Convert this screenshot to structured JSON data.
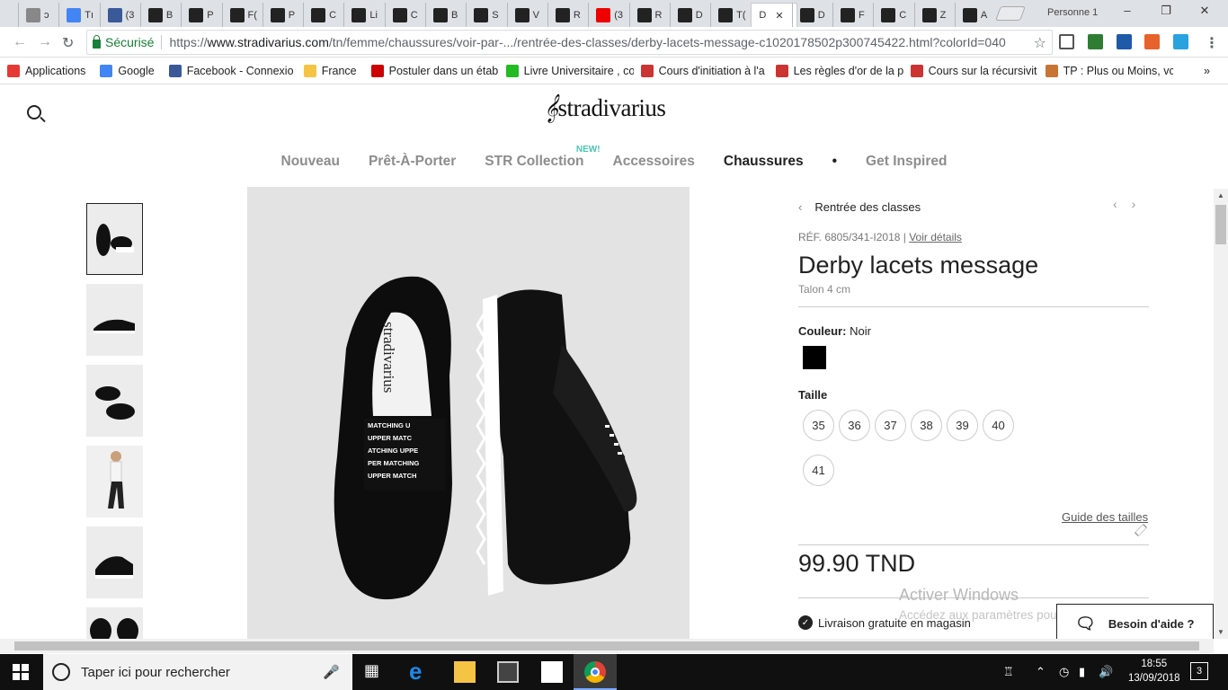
{
  "browser": {
    "tabs": [
      {
        "label": "ɔ",
        "icon": "doc-icon",
        "color": "#888"
      },
      {
        "label": "Tı",
        "icon": "google-icon",
        "color": "#4285f4"
      },
      {
        "label": "(3",
        "icon": "facebook-icon",
        "color": "#3b5998"
      },
      {
        "label": "B",
        "icon": "b-icon",
        "color": "#222"
      },
      {
        "label": "P",
        "icon": "b-icon",
        "color": "#222"
      },
      {
        "label": "F(",
        "icon": "b-icon",
        "color": "#222"
      },
      {
        "label": "P",
        "icon": "pnb-icon",
        "color": "#222"
      },
      {
        "label": "C",
        "icon": "pnb-icon",
        "color": "#222"
      },
      {
        "label": "Li",
        "icon": "pnb-icon",
        "color": "#222"
      },
      {
        "label": "C",
        "icon": "pnb-icon",
        "color": "#222"
      },
      {
        "label": "B",
        "icon": "pnb-icon",
        "color": "#222"
      },
      {
        "label": "S",
        "icon": "pnb-icon",
        "color": "#222"
      },
      {
        "label": "V",
        "icon": "pnb-icon",
        "color": "#222"
      },
      {
        "label": "R",
        "icon": "pnb-icon",
        "color": "#222"
      },
      {
        "label": "(3",
        "icon": "youtube-icon",
        "color": "#e00"
      },
      {
        "label": "R",
        "icon": "stradivarius-icon",
        "color": "#222"
      },
      {
        "label": "D",
        "icon": "stradivarius-icon",
        "color": "#222"
      },
      {
        "label": "T(",
        "icon": "stradivarius-icon",
        "color": "#222"
      },
      {
        "label": "D",
        "icon": "none",
        "color": "#222",
        "active": true
      },
      {
        "label": "D",
        "icon": "stradivarius-icon",
        "color": "#222"
      },
      {
        "label": "F",
        "icon": "z-icon",
        "color": "#222"
      },
      {
        "label": "C",
        "icon": "z-icon",
        "color": "#222"
      },
      {
        "label": "Z",
        "icon": "z-icon",
        "color": "#222"
      },
      {
        "label": "A",
        "icon": "z-icon",
        "color": "#222"
      }
    ],
    "active_tab_close": "✕",
    "profile": "Personne 1",
    "security_label": "Sécurisé",
    "url_prefix": "https://",
    "url_domain": "www.stradivarius.com",
    "url_path": "/tn/femme/chaussures/voir-par-.../rentrée-des-classes/derby-lacets-message-c1020178502p300745422.html?colorId=040",
    "bookmarks": [
      {
        "label": "Applications",
        "icon": "apps-icon",
        "color": "#e53935"
      },
      {
        "label": "Google",
        "icon": "google-icon",
        "color": "#4285f4"
      },
      {
        "label": "Facebook - Connexio",
        "icon": "facebook-icon",
        "color": "#3b5998"
      },
      {
        "label": "France",
        "icon": "folder-icon",
        "color": "#f6c445"
      },
      {
        "label": "Postuler dans un étab",
        "icon": "job-icon",
        "color": "#c00"
      },
      {
        "label": "Livre Universitaire , co",
        "icon": "book-icon",
        "color": "#2b2"
      },
      {
        "label": "Cours d'initiation à l'a",
        "icon": "oc-icon",
        "color": "#c33"
      },
      {
        "label": "Les règles d'or de la p",
        "icon": "oc-icon",
        "color": "#c33"
      },
      {
        "label": "Cours sur la récursivit",
        "icon": "oc-icon",
        "color": "#c33"
      },
      {
        "label": "TP : Plus ou Moins, vc",
        "icon": "cookie-icon",
        "color": "#c87533"
      }
    ],
    "more_bookmarks": "»"
  },
  "site": {
    "logo": "stradivarius",
    "nav": [
      {
        "label": "Nouveau",
        "active": false
      },
      {
        "label": "Prêt-À-Porter",
        "active": false
      },
      {
        "label": "STR Collection",
        "active": false,
        "badge": "NEW!"
      },
      {
        "label": "Accessoires",
        "active": false
      },
      {
        "label": "Chaussures",
        "active": true
      },
      {
        "label": "•",
        "active": false
      },
      {
        "label": "Get Inspired",
        "active": false
      }
    ]
  },
  "product": {
    "breadcrumb": "Rentrée des classes",
    "ref_prefix": "RÉF. 6805/341-I2018 |",
    "ref_link": "Voir détails",
    "title": "Derby lacets message",
    "subtitle": "Talon 4 cm",
    "color_label": "Couleur:",
    "color_value": "Noir",
    "swatch_color": "#000000",
    "size_label": "Taille",
    "sizes": [
      "35",
      "36",
      "37",
      "38",
      "39",
      "40",
      "41"
    ],
    "size_guide": "Guide des tailles",
    "price": "99.90 TND",
    "delivery": "Livraison gratuite en magasin",
    "help": "Besoin d'aide ?",
    "lace_text": [
      "MATCHING U",
      "UPPER MATC",
      "ATCHING UPPE",
      "PER MATCHING",
      "UPPER MATCH"
    ],
    "insole_brand": "stradivarius"
  },
  "windows": {
    "watermark_title": "Activer Windows",
    "watermark_sub": "Accédez aux paramètres pour activer Windows.",
    "search_placeholder": "Taper ici pour rechercher",
    "time": "18:55",
    "date": "13/09/2018",
    "notifications": "3"
  }
}
